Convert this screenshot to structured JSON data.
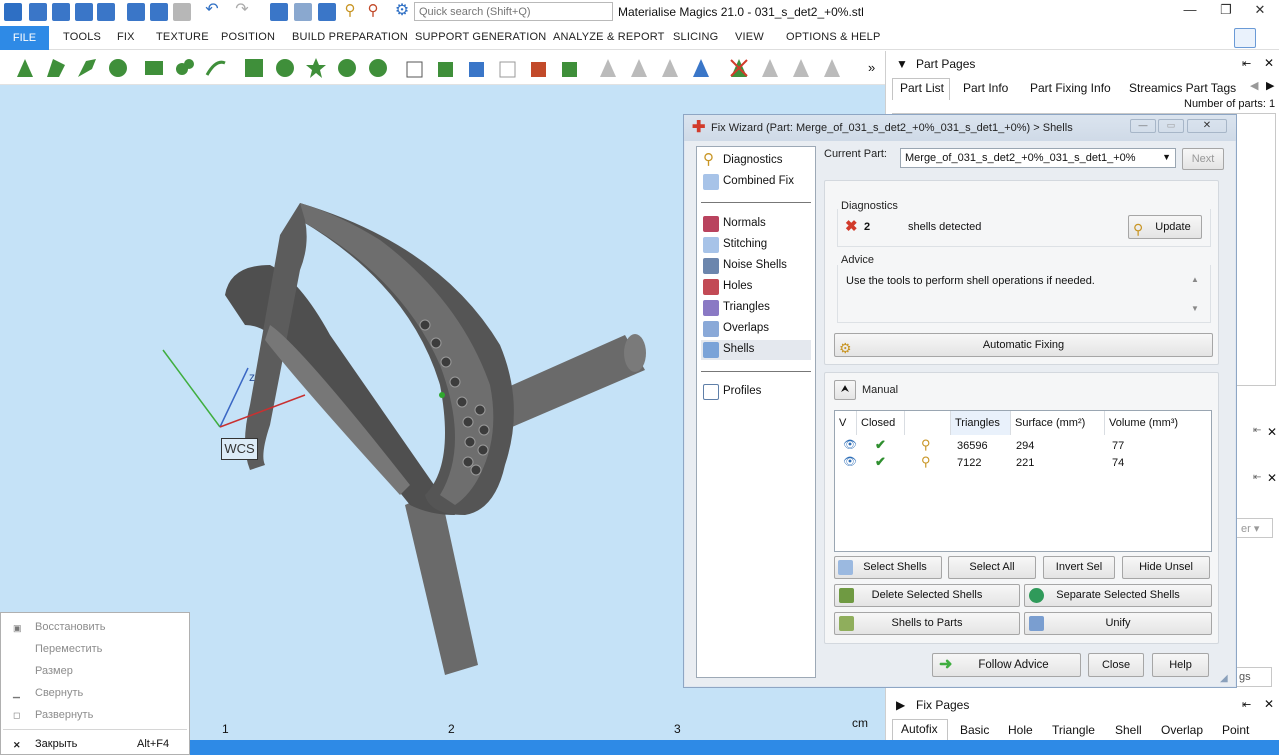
{
  "app": {
    "title": "Materialise Magics 21.0 - 031_s_det2_+0%.stl",
    "search_placeholder": "Quick search (Shift+Q)"
  },
  "menu": [
    "FILE",
    "TOOLS",
    "FIX",
    "TEXTURE",
    "POSITION",
    "BUILD PREPARATION",
    "SUPPORT GENERATION",
    "ANALYZE & REPORT",
    "SLICING",
    "VIEW",
    "OPTIONS & HELP"
  ],
  "viewport": {
    "wcs_label": "WCS",
    "axis_z": "z",
    "ruler": [
      "1",
      "2",
      "3"
    ],
    "unit": "cm"
  },
  "part_pages": {
    "title": "Part Pages",
    "tabs": [
      "Part List",
      "Part Info",
      "Part Fixing Info",
      "Streamics Part Tags"
    ],
    "num_parts": "Number of parts: 1",
    "partial_text": "er",
    "partial_text2": "gs"
  },
  "fix_pages": {
    "title": "Fix Pages",
    "tabs": [
      "Autofix",
      "Basic",
      "Hole",
      "Triangle",
      "Shell",
      "Overlap",
      "Point"
    ]
  },
  "wizard": {
    "title": "Fix Wizard (Part: Merge_of_031_s_det2_+0%_031_s_det1_+0%) > Shells",
    "nav_top": [
      "Diagnostics",
      "Combined Fix"
    ],
    "nav_checks": [
      "Normals",
      "Stitching",
      "Noise Shells",
      "Holes",
      "Triangles",
      "Overlaps",
      "Shells"
    ],
    "nav_bottom": [
      "Profiles"
    ],
    "current_part_label": "Current Part:",
    "current_part_value": "Merge_of_031_s_det2_+0%_031_s_det1_+0%",
    "next": "Next",
    "diagnostics_label": "Diagnostics",
    "shell_count": "2",
    "shells_text": "shells detected",
    "update": "Update",
    "advice_label": "Advice",
    "advice_text": "Use the tools to perform shell operations if needed.",
    "automatic_fixing": "Automatic Fixing",
    "manual_label": "Manual",
    "columns": [
      "V",
      "Closed",
      "",
      "Triangles",
      "Surface (mm²)",
      "Volume (mm³)"
    ],
    "rows": [
      {
        "triangles": "36596",
        "surface": "294",
        "volume": "77"
      },
      {
        "triangles": "7122",
        "surface": "221",
        "volume": "74"
      }
    ],
    "buttons": {
      "select_shells": "Select Shells",
      "select_all": "Select All",
      "invert_sel": "Invert Sel",
      "hide_unsel": "Hide Unsel",
      "delete_selected": "Delete Selected Shells",
      "separate_selected": "Separate Selected Shells",
      "shells_to_parts": "Shells to Parts",
      "unify": "Unify",
      "follow_advice": "Follow Advice",
      "close": "Close",
      "help": "Help"
    }
  },
  "context_menu": [
    {
      "label": "Восстановить",
      "icon": "restore-icon"
    },
    {
      "label": "Переместить",
      "icon": ""
    },
    {
      "label": "Размер",
      "icon": ""
    },
    {
      "label": "Свернуть",
      "icon": "minimize-icon"
    },
    {
      "label": "Развернуть",
      "icon": "maximize-icon"
    },
    {
      "label": "Закрыть",
      "shortcut": "Alt+F4",
      "icon": "close-icon"
    }
  ],
  "colors": {
    "accent": "#2e8ae6",
    "viewport_bg": "#c5e2f7",
    "tool_green": "#3f8f3a",
    "error_red": "#d23b2b",
    "ok_green": "#2f8f2f"
  }
}
